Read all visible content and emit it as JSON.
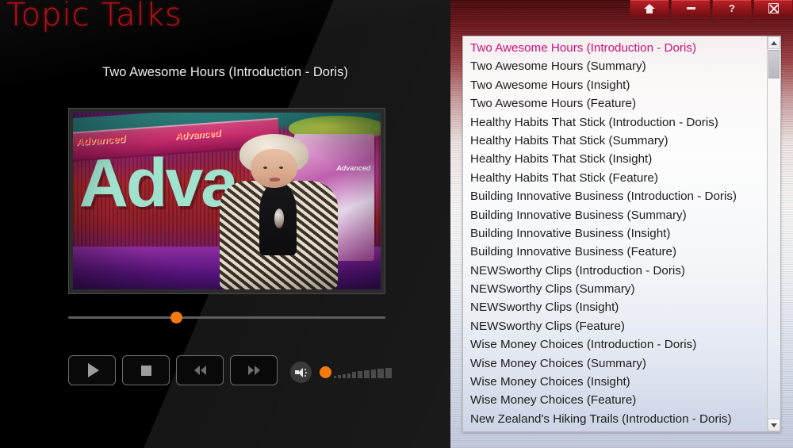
{
  "app": {
    "title": "Topic Talks"
  },
  "titlebar": {
    "buttons": [
      {
        "name": "home-button",
        "icon": "home-icon",
        "label": ""
      },
      {
        "name": "minimize-button",
        "icon": "minimize-icon",
        "label": ""
      },
      {
        "name": "help-button",
        "icon": "help-icon",
        "label": "?"
      },
      {
        "name": "close-button",
        "icon": "close-icon",
        "label": ""
      }
    ]
  },
  "player": {
    "now_playing_title": "Two Awesome Hours (Introduction - Doris)",
    "progress_percent": 34,
    "volume_percent": 18,
    "controls": {
      "play_label": "Play",
      "stop_label": "Stop",
      "rewind_label": "Rewind",
      "fast_forward_label": "Fast Forward",
      "mute_label": "Mute"
    },
    "video_still": {
      "set_text": "Adva",
      "banner_text": "Advanced",
      "banner_text2": "Advanced",
      "panel_text": "Advanced"
    }
  },
  "playlist": {
    "selected_index": 0,
    "items": [
      "Two Awesome Hours (Introduction - Doris)",
      "Two Awesome Hours (Summary)",
      "Two Awesome Hours (Insight)",
      "Two Awesome Hours (Feature)",
      "Healthy Habits That Stick (Introduction - Doris)",
      "Healthy Habits That Stick (Summary)",
      "Healthy Habits That Stick (Insight)",
      "Healthy Habits That Stick (Feature)",
      "Building Innovative Business (Introduction - Doris)",
      "Building Innovative Business (Summary)",
      "Building Innovative Business (Insight)",
      "Building Innovative Business (Feature)",
      "NEWSworthy Clips (Introduction - Doris)",
      "NEWSworthy Clips (Summary)",
      "NEWSworthy Clips (Insight)",
      "NEWSworthy Clips (Feature)",
      "Wise Money Choices (Introduction - Doris)",
      "Wise Money Choices (Summary)",
      "Wise Money Choices (Insight)",
      "Wise Money Choices (Feature)",
      "New Zealand's Hiking Trails (Introduction - Doris)"
    ]
  },
  "colors": {
    "brand_red": "#b4121a",
    "accent_orange": "#f4790f",
    "selected_text": "#cc1177",
    "titlebar_red": "#9a171c"
  }
}
